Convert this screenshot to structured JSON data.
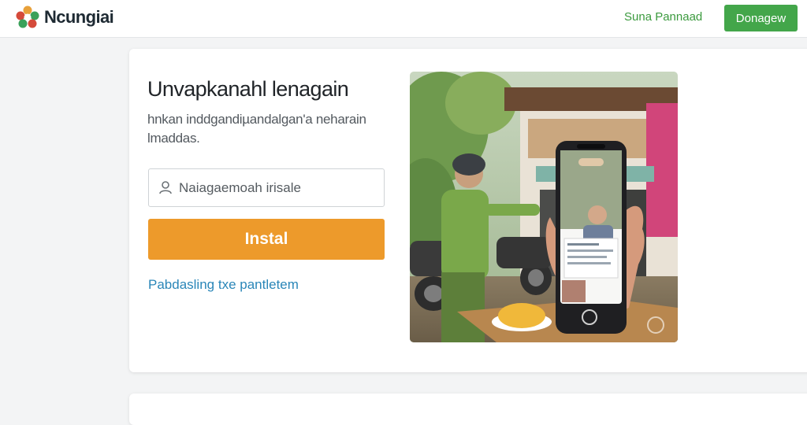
{
  "header": {
    "brand": "Ncungiai",
    "nav_link": "Suna Pannaad",
    "cta_label": "Donagew"
  },
  "hero": {
    "headline": "Unvapkanahl lenagain",
    "subtext": "hnkan inddgandiµandalgan'a neharain lmaddas.",
    "search": {
      "placeholder": "Naiagaemoah irisale",
      "value": ""
    },
    "install_label": "Instal",
    "link_label": "Pabdasling  txe pantletem"
  },
  "colors": {
    "brand_green": "#43a64a",
    "install_orange": "#ed9a2b",
    "link_blue": "#2a86b8"
  },
  "icons": [
    "logo-icon",
    "search-icon"
  ]
}
